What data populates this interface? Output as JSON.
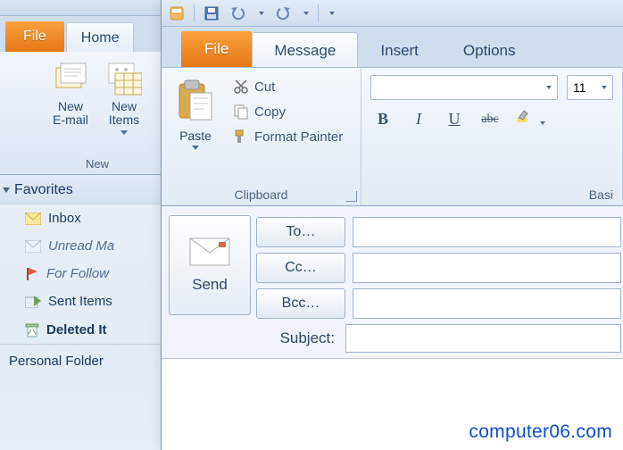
{
  "colors": {
    "accent": "#e67817",
    "link": "#0a4fd0"
  },
  "back": {
    "file_label": "File",
    "tab_home": "Home",
    "new_email_label": "New\nE-mail",
    "new_items_label": "New\nItems",
    "group_new": "New",
    "fav_header": "Favorites",
    "items": [
      {
        "label": "Inbox",
        "icon": "inbox"
      },
      {
        "label": "Unread Ma",
        "icon": "unread",
        "style": "italic"
      },
      {
        "label": "For Follow",
        "icon": "follow",
        "style": "italic"
      },
      {
        "label": "Sent Items",
        "icon": "sent"
      },
      {
        "label": "Deleted It",
        "icon": "deleted",
        "style": "bold"
      }
    ],
    "pf_header": "Personal Folder"
  },
  "front": {
    "file_label": "File",
    "tabs": {
      "message": "Message",
      "insert": "Insert",
      "options": "Options"
    },
    "clipboard": {
      "paste": "Paste",
      "cut": "Cut",
      "copy": "Copy",
      "fpainter": "Format Painter",
      "group": "Clipboard"
    },
    "font": {
      "name_value": "",
      "size_value": "11",
      "bold": "B",
      "italic": "I",
      "underline": "U",
      "strike": "abc",
      "group": "Basi"
    },
    "compose": {
      "send": "Send",
      "to": "To…",
      "cc": "Cc…",
      "bcc": "Bcc…",
      "subject_label": "Subject:"
    }
  },
  "watermark": "computer06.com"
}
